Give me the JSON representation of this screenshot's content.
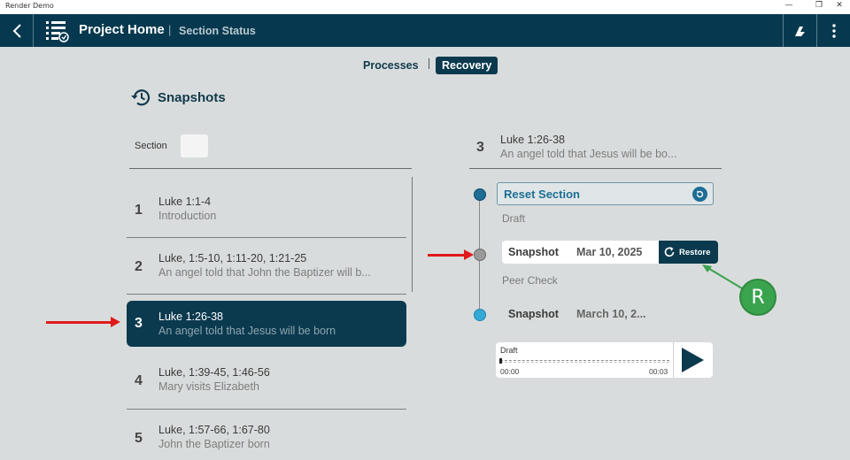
{
  "window": {
    "title": "Render Demo",
    "min": "—",
    "max": "❐",
    "close": "✕"
  },
  "header": {
    "title": "Project Home",
    "separator": "|",
    "subtitle": "Section Status"
  },
  "tabs": {
    "processes": "Processes",
    "recovery": "Recovery",
    "active": "Recovery"
  },
  "snapshots": {
    "heading": "Snapshots",
    "section_label": "Section"
  },
  "sections": [
    {
      "num": "1",
      "ref": "Luke 1:1-4",
      "desc": "Introduction"
    },
    {
      "num": "2",
      "ref": "Luke, 1:5-10, 1:11-20, 1:21-25",
      "desc": "An angel told that John the Baptizer will b..."
    },
    {
      "num": "3",
      "ref": "Luke 1:26-38",
      "desc": "An angel told that Jesus will be born",
      "selected": true
    },
    {
      "num": "4",
      "ref": "Luke, 1:39-45, 1:46-56",
      "desc": "Mary visits Elizabeth"
    },
    {
      "num": "5",
      "ref": "Luke, 1:57-66, 1:67-80",
      "desc": "John the Baptizer born"
    }
  ],
  "detail": {
    "num": "3",
    "ref": "Luke 1:26-38",
    "desc": "An angel told that Jesus will be bo...",
    "reset_label": "Reset Section",
    "stage1": "Draft",
    "snapshot1": {
      "label": "Snapshot",
      "date": "Mar 10, 2025",
      "restore": "Restore"
    },
    "stage2": "Peer Check",
    "snapshot2": {
      "label": "Snapshot",
      "date": "March 10, 2..."
    },
    "player": {
      "label": "Draft",
      "start": "00:00",
      "end": "00:03"
    }
  },
  "annotation": {
    "badge": "R"
  },
  "colors": {
    "primary": "#0b3a4f",
    "accent": "#1d6e94",
    "arrow": "#e0191b",
    "badge": "#3aa34e"
  }
}
